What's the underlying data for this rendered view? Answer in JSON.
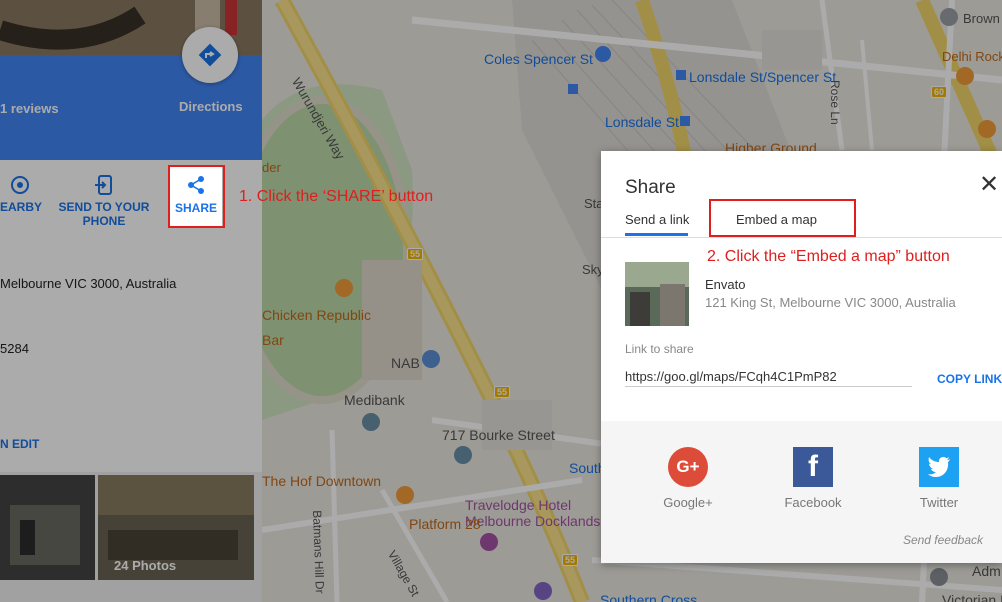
{
  "panel": {
    "reviews": "1 reviews",
    "directions_label": "Directions",
    "actions": [
      {
        "label_line1": "EARBY",
        "label_line2": ""
      },
      {
        "label_line1": "SEND TO YOUR",
        "label_line2": "PHONE"
      },
      {
        "label_line1": "SHARE",
        "label_line2": ""
      }
    ],
    "address": "Melbourne VIC 3000, Australia",
    "phone": "5284",
    "edit": "N EDIT",
    "photos_label": "24 Photos"
  },
  "map": {
    "labels": {
      "coles": "Coles Spencer St",
      "lonsdale_spencer": "Lonsdale St/Spencer St",
      "lonsdale_st": "Lonsdale St",
      "wurundjeri": "Wurundjeri Way",
      "higher_ground": "Higher Ground",
      "brown": "Brown",
      "delhi": "Delhi Rock",
      "rose_ln": "Rose Ln",
      "chicken": "Chicken Republic",
      "bar": "Bar",
      "der": "der",
      "nab": "NAB",
      "medibank": "Medibank",
      "bourke": "717 Bourke Street",
      "hof": "The Hof Downtown",
      "platform": "Platform 28",
      "travelodge1": "Travelodge Hotel",
      "travelodge2": "Melbourne Docklands",
      "batmans": "Batmans Hill Dr",
      "village": "Village St",
      "south": "South",
      "southern_cross": "Southern Cross",
      "victorian": "Victorian R",
      "adm": "Adm",
      "sta": "Sta",
      "sky": "Sky",
      "shield_55": "55",
      "shield_60": "60"
    }
  },
  "share": {
    "title": "Share",
    "tab_send": "Send a link",
    "tab_embed": "Embed a map",
    "place_name": "Envato",
    "place_address": "121 King St, Melbourne VIC 3000, Australia",
    "link_label": "Link to share",
    "link_value": "https://goo.gl/maps/FCqh4C1PmP82",
    "copy_link": "COPY LINK",
    "social": [
      {
        "name": "Google+",
        "icon": "google-plus-icon",
        "color": "#dd4b39",
        "glyph": "G+"
      },
      {
        "name": "Facebook",
        "icon": "facebook-icon",
        "color": "#3b5998",
        "glyph": "f"
      },
      {
        "name": "Twitter",
        "icon": "twitter-icon",
        "color": "#1da1f2",
        "glyph": "🐦"
      }
    ],
    "feedback": "Send feedback"
  },
  "annotations": {
    "step1": "1. Click the ‘SHARE’ button",
    "step2": "2. Click the “Embed a map” button"
  },
  "colors": {
    "accent": "#1a73e8",
    "annotation": "#e01e1e",
    "header_blue": "#4285f4"
  }
}
